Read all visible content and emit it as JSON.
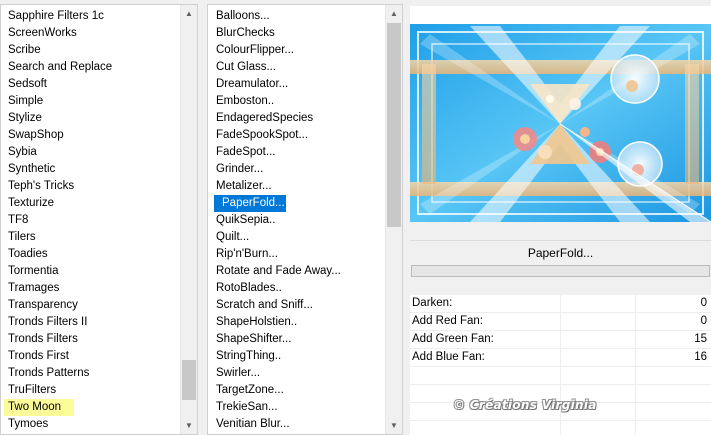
{
  "categories": {
    "items": [
      "Sapphire Filters 1c",
      "ScreenWorks",
      "Scribe",
      "Search and Replace",
      "Sedsoft",
      "Simple",
      "Stylize",
      "SwapShop",
      "Sybia",
      "Synthetic",
      "Teph's Tricks",
      "Texturize",
      "TF8",
      "Tilers",
      "Toadies",
      "Tormentia",
      "Tramages",
      "Transparency",
      "Tronds Filters II",
      "Tronds Filters",
      "Tronds First",
      "Tronds Patterns",
      "TruFilters",
      "Two Moon",
      "Tymoes"
    ],
    "highlighted": "Two Moon",
    "scroll_position": 0.93
  },
  "filters": {
    "items": [
      "Balloons...",
      "BlurChecks",
      "ColourFlipper...",
      "Cut Glass...",
      "Dreamulator...",
      "Emboston..",
      "EndageredSpecies",
      "FadeSpookSpot...",
      "FadeSpot...",
      "Grinder...",
      "Metalizer...",
      "PaperFold...",
      "QuikSepia..",
      "Quilt...",
      "Rip'n'Burn...",
      "Rotate and Fade Away...",
      "RotoBlades..",
      "Scratch and Sniff...",
      "ShapeHolstien..",
      "ShapeShifter...",
      "StringThing..",
      "Swirler...",
      "TargetZone...",
      "TrekieSan...",
      "Venitian Blur..."
    ],
    "selected": "PaperFold...",
    "scroll_position": 0.0
  },
  "filter_name_button": "PaperFold...",
  "progress": 0,
  "parameters": [
    {
      "label": "Darken:",
      "value": "0"
    },
    {
      "label": "Add Red Fan:",
      "value": "0"
    },
    {
      "label": "Add Green Fan:",
      "value": "15"
    },
    {
      "label": "Add Blue Fan:",
      "value": "16"
    }
  ],
  "watermark": "© Créations Virginia",
  "colors": {
    "selection": "#0078d7",
    "highlight": "#fbfb99",
    "preview_blue": "#2aa8f0",
    "preview_peach": "#f3c58a"
  },
  "icons": {
    "scroll_up": "▲",
    "scroll_down": "▼"
  }
}
